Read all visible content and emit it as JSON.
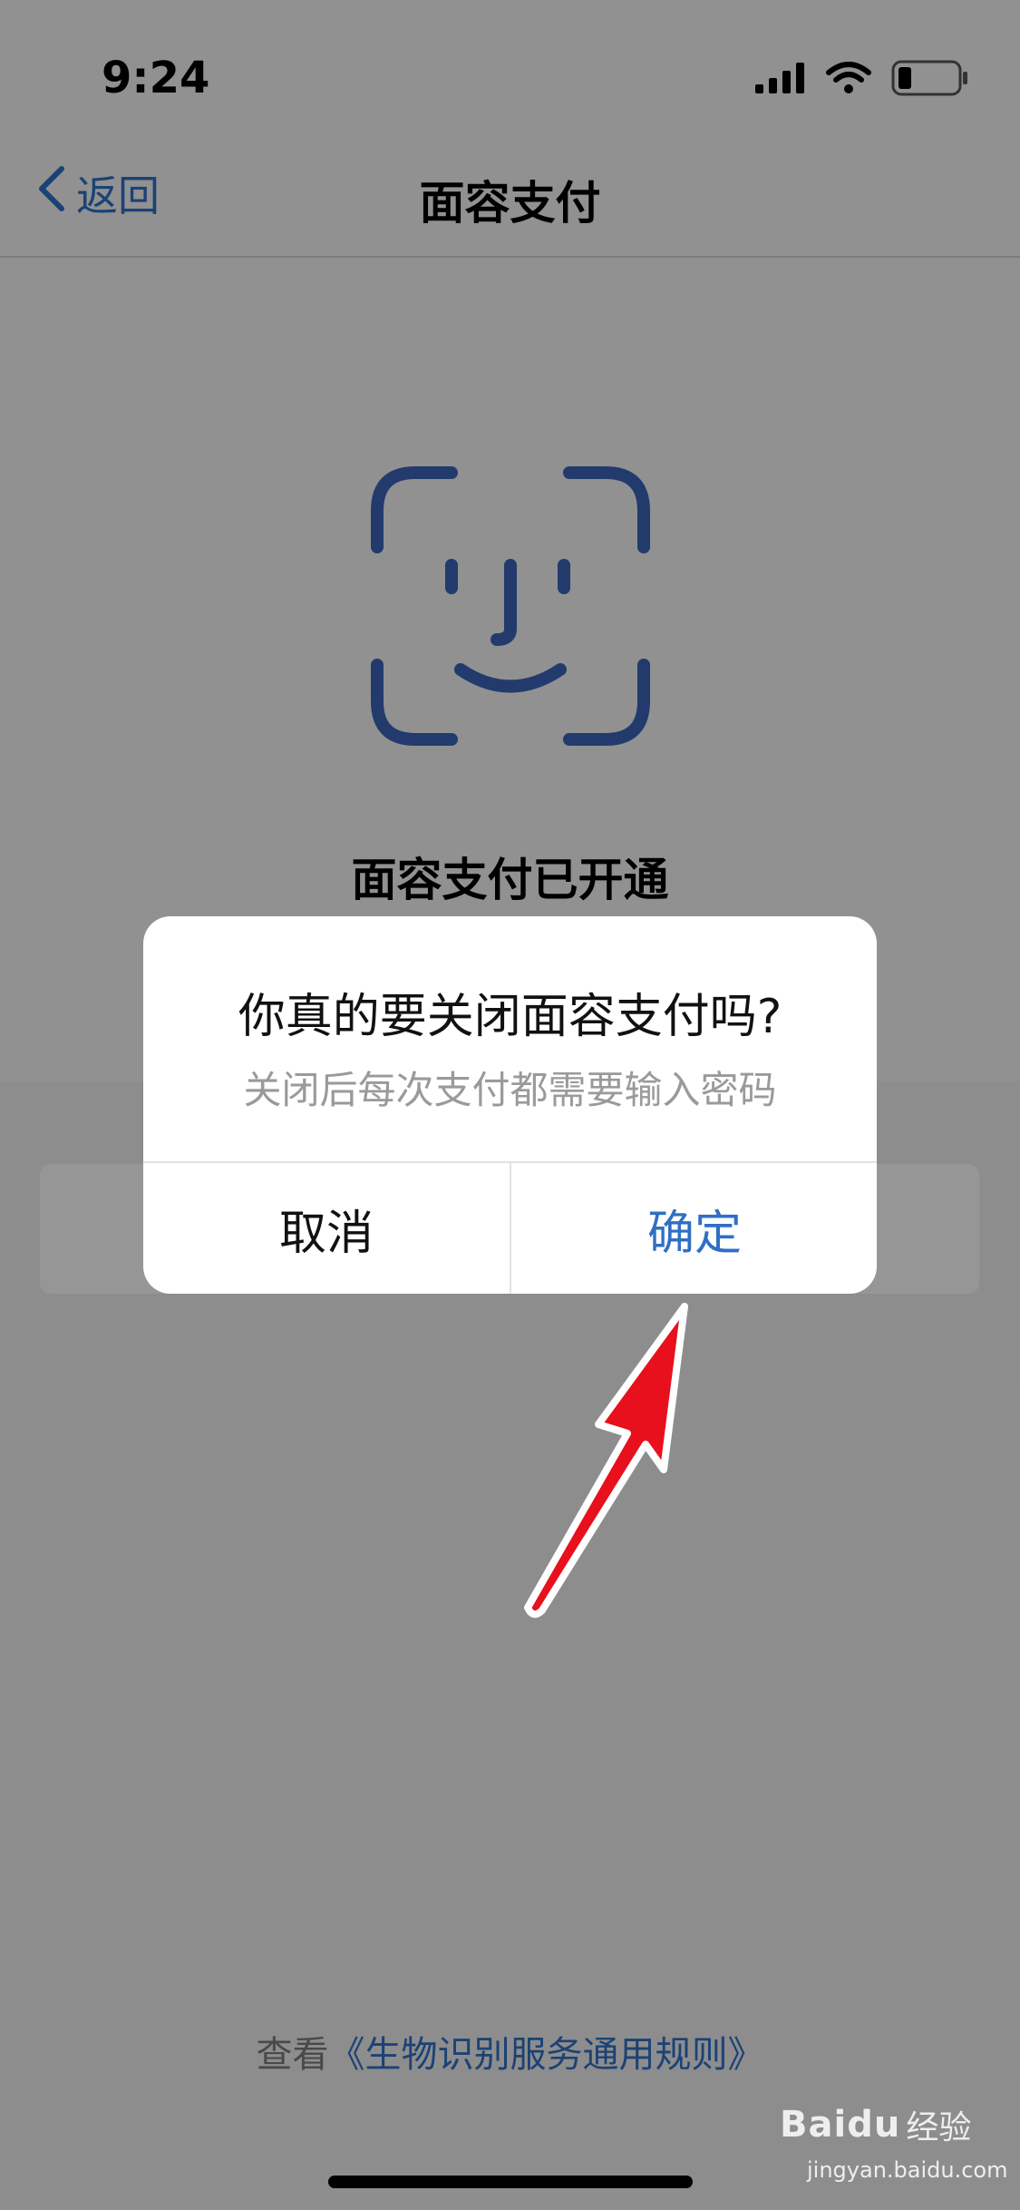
{
  "status_bar": {
    "time": "9:24"
  },
  "nav": {
    "back_label": "返回",
    "title": "面容支付"
  },
  "main": {
    "status_title": "面容支付已开通",
    "footer_prefix": "查看",
    "footer_link": "《生物识别服务通用规则》"
  },
  "dialog": {
    "title": "你真的要关闭面容支付吗?",
    "message": "关闭后每次支付都需要输入密码",
    "cancel_label": "取消",
    "confirm_label": "确定"
  },
  "watermark": {
    "brand": "Baidu",
    "label": "经验",
    "url": "jingyan.baidu.com"
  },
  "colors": {
    "accent": "#2f6fc4",
    "faceid": "#3a63b5",
    "arrow": "#e8101c"
  },
  "icons": [
    "chevron-left-icon",
    "signal-icon",
    "wifi-icon",
    "battery-icon",
    "face-id-icon",
    "pointer-arrow-icon"
  ]
}
